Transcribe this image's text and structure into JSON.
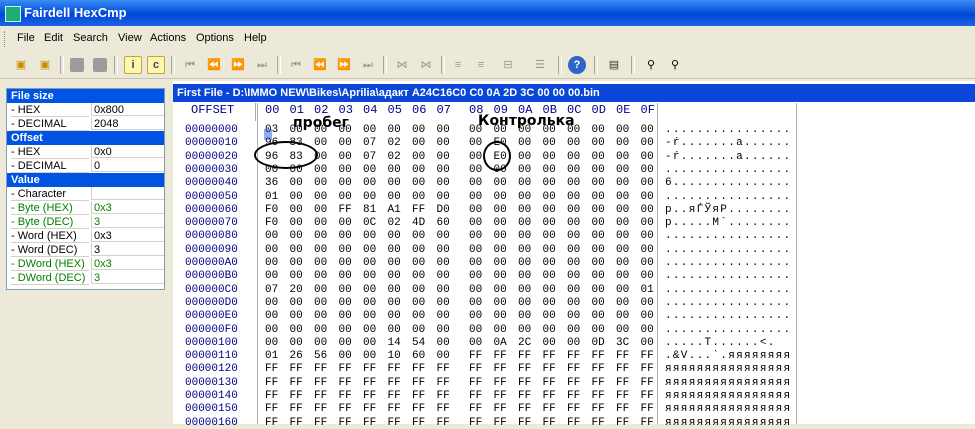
{
  "window": {
    "title": "Fairdell HexCmp"
  },
  "menu": [
    "File",
    "Edit",
    "Search",
    "View",
    "Actions",
    "Options",
    "Help"
  ],
  "toolbar_icons": [
    "open-file-icon",
    "open-second-file-icon",
    "gray-square-icon",
    "gray-square-icon",
    "info-icon",
    "compare-icon",
    "first-diff-icon",
    "prev-diff-icon",
    "next-diff-icon",
    "last-diff-icon",
    "first-icon",
    "prev-icon",
    "next-icon",
    "last-icon",
    "sync-left-icon",
    "sync-right-icon",
    "align-icon",
    "align2-icon",
    "bracket-icon",
    "list-icon",
    "help-icon",
    "report-icon",
    "find-icon",
    "find-next-icon"
  ],
  "properties": [
    {
      "type": "section",
      "label": "File size"
    },
    {
      "type": "item",
      "label": "- HEX",
      "value": "0x800"
    },
    {
      "type": "item",
      "label": "- DECIMAL",
      "value": "2048"
    },
    {
      "type": "section",
      "label": "Offset"
    },
    {
      "type": "item",
      "label": "- HEX",
      "value": "0x0"
    },
    {
      "type": "item",
      "label": "- DECIMAL",
      "value": "0"
    },
    {
      "type": "section",
      "label": "Value"
    },
    {
      "type": "item",
      "label": "- Character",
      "value": ""
    },
    {
      "type": "item",
      "label": "- Byte (HEX)",
      "value": "0x3",
      "green": true
    },
    {
      "type": "item",
      "label": "- Byte (DEC)",
      "value": "3",
      "green": true
    },
    {
      "type": "item",
      "label": "- Word (HEX)",
      "value": "0x3"
    },
    {
      "type": "item",
      "label": "- Word (DEC)",
      "value": "3"
    },
    {
      "type": "item",
      "label": "- DWord (HEX)",
      "value": "0x3",
      "green": true
    },
    {
      "type": "item",
      "label": "- DWord (DEC)",
      "value": "3",
      "green": true
    }
  ],
  "file": {
    "path_label": "First File - D:\\IMMO NEW\\Bikes\\Aprilia\\адакт A24C16C0 C0 0A 2D 3C 00 00 00.bin"
  },
  "hex": {
    "offset_header": "OFFSET",
    "column_headers": [
      "00",
      "01",
      "02",
      "03",
      "04",
      "05",
      "06",
      "07",
      "08",
      "09",
      "0A",
      "0B",
      "0C",
      "0D",
      "0E",
      "0F"
    ],
    "rows": [
      {
        "off": "00000000",
        "b": [
          "03",
          "00",
          "00",
          "00",
          "00",
          "00",
          "00",
          "00",
          "00",
          "00",
          "00",
          "00",
          "00",
          "00",
          "00",
          "00"
        ],
        "asc": "................"
      },
      {
        "off": "00000010",
        "b": [
          "96",
          "83",
          "00",
          "00",
          "07",
          "02",
          "00",
          "00",
          "00",
          "E0",
          "00",
          "00",
          "00",
          "00",
          "00",
          "00"
        ],
        "asc": "-ŕ.......а......"
      },
      {
        "off": "00000020",
        "b": [
          "96",
          "83",
          "00",
          "00",
          "07",
          "02",
          "00",
          "00",
          "00",
          "E0",
          "00",
          "00",
          "00",
          "00",
          "00",
          "00"
        ],
        "asc": "-ŕ.......а......"
      },
      {
        "off": "00000030",
        "b": [
          "00",
          "00",
          "00",
          "00",
          "00",
          "00",
          "00",
          "00",
          "00",
          "00",
          "00",
          "00",
          "00",
          "00",
          "00",
          "00"
        ],
        "asc": "................"
      },
      {
        "off": "00000040",
        "b": [
          "36",
          "00",
          "00",
          "00",
          "00",
          "00",
          "00",
          "00",
          "00",
          "00",
          "00",
          "00",
          "00",
          "00",
          "00",
          "00"
        ],
        "asc": "6..............."
      },
      {
        "off": "00000050",
        "b": [
          "01",
          "00",
          "00",
          "00",
          "00",
          "00",
          "00",
          "00",
          "00",
          "00",
          "00",
          "00",
          "00",
          "00",
          "00",
          "00"
        ],
        "asc": "................"
      },
      {
        "off": "00000060",
        "b": [
          "F0",
          "00",
          "00",
          "FF",
          "81",
          "A1",
          "FF",
          "D0",
          "00",
          "00",
          "00",
          "00",
          "00",
          "00",
          "00",
          "00"
        ],
        "asc": "р..яЃЎяР........"
      },
      {
        "off": "00000070",
        "b": [
          "F0",
          "00",
          "00",
          "00",
          "0C",
          "02",
          "4D",
          "60",
          "00",
          "00",
          "00",
          "00",
          "00",
          "00",
          "00",
          "00"
        ],
        "asc": "р.....M`........"
      },
      {
        "off": "00000080",
        "b": [
          "00",
          "00",
          "00",
          "00",
          "00",
          "00",
          "00",
          "00",
          "00",
          "00",
          "00",
          "00",
          "00",
          "00",
          "00",
          "00"
        ],
        "asc": "................"
      },
      {
        "off": "00000090",
        "b": [
          "00",
          "00",
          "00",
          "00",
          "00",
          "00",
          "00",
          "00",
          "00",
          "00",
          "00",
          "00",
          "00",
          "00",
          "00",
          "00"
        ],
        "asc": "................"
      },
      {
        "off": "000000A0",
        "b": [
          "00",
          "00",
          "00",
          "00",
          "00",
          "00",
          "00",
          "00",
          "00",
          "00",
          "00",
          "00",
          "00",
          "00",
          "00",
          "00"
        ],
        "asc": "................"
      },
      {
        "off": "000000B0",
        "b": [
          "00",
          "00",
          "00",
          "00",
          "00",
          "00",
          "00",
          "00",
          "00",
          "00",
          "00",
          "00",
          "00",
          "00",
          "00",
          "00"
        ],
        "asc": "................"
      },
      {
        "off": "000000C0",
        "b": [
          "07",
          "20",
          "00",
          "00",
          "00",
          "00",
          "00",
          "00",
          "00",
          "00",
          "00",
          "00",
          "00",
          "00",
          "00",
          "01"
        ],
        "asc": "................"
      },
      {
        "off": "000000D0",
        "b": [
          "00",
          "00",
          "00",
          "00",
          "00",
          "00",
          "00",
          "00",
          "00",
          "00",
          "00",
          "00",
          "00",
          "00",
          "00",
          "00"
        ],
        "asc": "................"
      },
      {
        "off": "000000E0",
        "b": [
          "00",
          "00",
          "00",
          "00",
          "00",
          "00",
          "00",
          "00",
          "00",
          "00",
          "00",
          "00",
          "00",
          "00",
          "00",
          "00"
        ],
        "asc": "................"
      },
      {
        "off": "000000F0",
        "b": [
          "00",
          "00",
          "00",
          "00",
          "00",
          "00",
          "00",
          "00",
          "00",
          "00",
          "00",
          "00",
          "00",
          "00",
          "00",
          "00"
        ],
        "asc": "................"
      },
      {
        "off": "00000100",
        "b": [
          "00",
          "00",
          "00",
          "00",
          "00",
          "14",
          "54",
          "00",
          "00",
          "0A",
          "2C",
          "00",
          "00",
          "0D",
          "3C",
          "00"
        ],
        "asc": ".....T......<."
      },
      {
        "off": "00000110",
        "b": [
          "01",
          "26",
          "56",
          "00",
          "00",
          "10",
          "60",
          "00",
          "FF",
          "FF",
          "FF",
          "FF",
          "FF",
          "FF",
          "FF",
          "FF"
        ],
        "asc": ".&V...`.яяяяяяяя"
      },
      {
        "off": "00000120",
        "b": [
          "FF",
          "FF",
          "FF",
          "FF",
          "FF",
          "FF",
          "FF",
          "FF",
          "FF",
          "FF",
          "FF",
          "FF",
          "FF",
          "FF",
          "FF",
          "FF"
        ],
        "asc": "яяяяяяяяяяяяяяяя"
      },
      {
        "off": "00000130",
        "b": [
          "FF",
          "FF",
          "FF",
          "FF",
          "FF",
          "FF",
          "FF",
          "FF",
          "FF",
          "FF",
          "FF",
          "FF",
          "FF",
          "FF",
          "FF",
          "FF"
        ],
        "asc": "яяяяяяяяяяяяяяяя"
      },
      {
        "off": "00000140",
        "b": [
          "FF",
          "FF",
          "FF",
          "FF",
          "FF",
          "FF",
          "FF",
          "FF",
          "FF",
          "FF",
          "FF",
          "FF",
          "FF",
          "FF",
          "FF",
          "FF"
        ],
        "asc": "яяяяяяяяяяяяяяяя"
      },
      {
        "off": "00000150",
        "b": [
          "FF",
          "FF",
          "FF",
          "FF",
          "FF",
          "FF",
          "FF",
          "FF",
          "FF",
          "FF",
          "FF",
          "FF",
          "FF",
          "FF",
          "FF",
          "FF"
        ],
        "asc": "яяяяяяяяяяяяяяяя"
      },
      {
        "off": "00000160",
        "b": [
          "FF",
          "FF",
          "FF",
          "FF",
          "FF",
          "FF",
          "FF",
          "FF",
          "FF",
          "FF",
          "FF",
          "FF",
          "FF",
          "FF",
          "FF",
          "FF"
        ],
        "asc": "яяяяяяяяяяяяяяяя"
      }
    ]
  },
  "annotations": {
    "mileage_label": "пробег",
    "checksum_label": "Контролька"
  }
}
